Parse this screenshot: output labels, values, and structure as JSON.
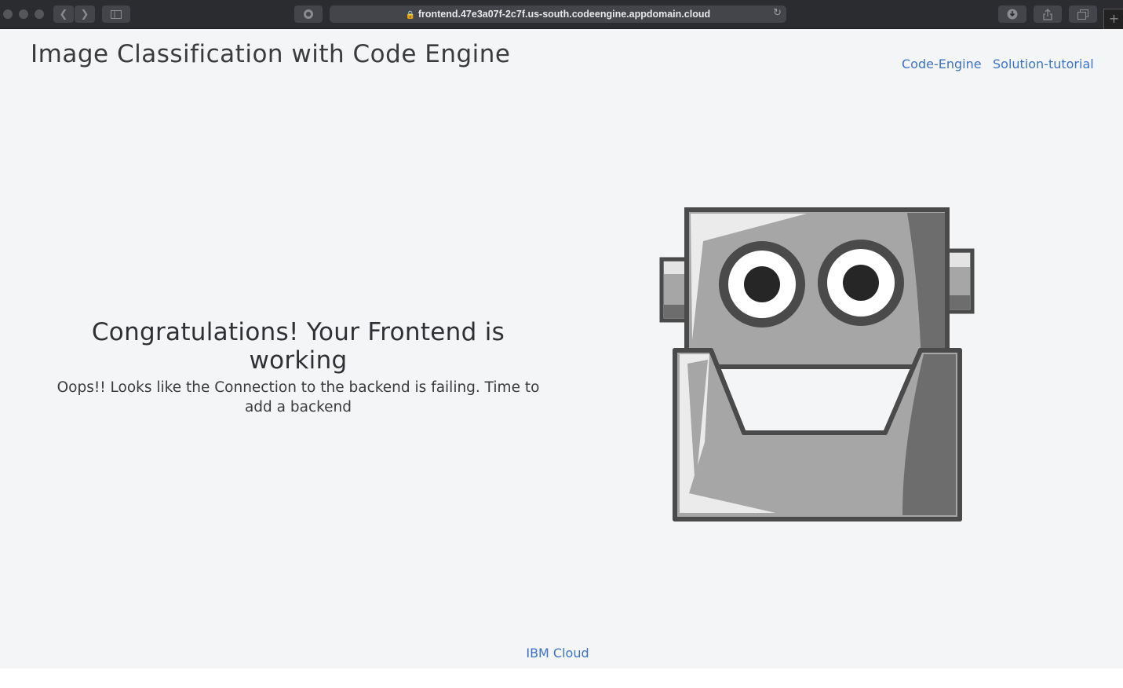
{
  "browser": {
    "url": "frontend.47e3a07f-2c7f.us-south.codeengine.appdomain.cloud",
    "new_tab": "+"
  },
  "header": {
    "title": "Image Classification with Code Engine",
    "links": [
      "Code-Engine",
      "Solution-tutorial"
    ]
  },
  "main": {
    "heading": "Congratulations! Your Frontend is working",
    "message": "Oops!! Looks like the Connection to the backend is failing. Time to add a backend"
  },
  "footer": {
    "link": "IBM Cloud"
  },
  "colors": {
    "link": "#3b73c8",
    "background": "#f4f5f7",
    "robot_dark": "#4a4a4a",
    "robot_mid": "#a6a6a6"
  }
}
